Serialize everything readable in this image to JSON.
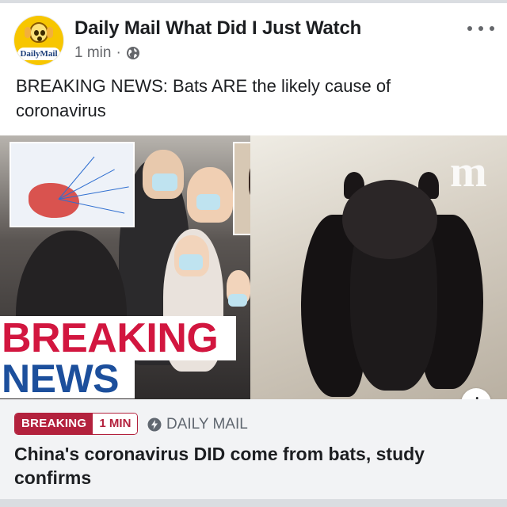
{
  "post": {
    "page_name": "Daily Mail What Did I Just Watch",
    "avatar_logo": "DailyMail",
    "timestamp": "1 min",
    "separator": "·",
    "privacy_icon": "globe-icon",
    "more_icon": "more-options-icon",
    "text": "BREAKING NEWS: Bats ARE the likely cause of coronavirus"
  },
  "image": {
    "overlay_line1": "BREAKING",
    "overlay_line2": "NEWS",
    "watermark": "m",
    "info_label": "i"
  },
  "link_preview": {
    "badge_label": "BREAKING",
    "badge_time": "1 MIN",
    "source_icon": "lightning-icon",
    "source": "DAILY MAIL",
    "headline": "China's coronavirus DID come from bats, study confirms"
  },
  "colors": {
    "breaking_red": "#d2163f",
    "news_blue": "#1c4f9c",
    "badge_red": "#b3213d",
    "avatar_yellow": "#f7c600"
  }
}
